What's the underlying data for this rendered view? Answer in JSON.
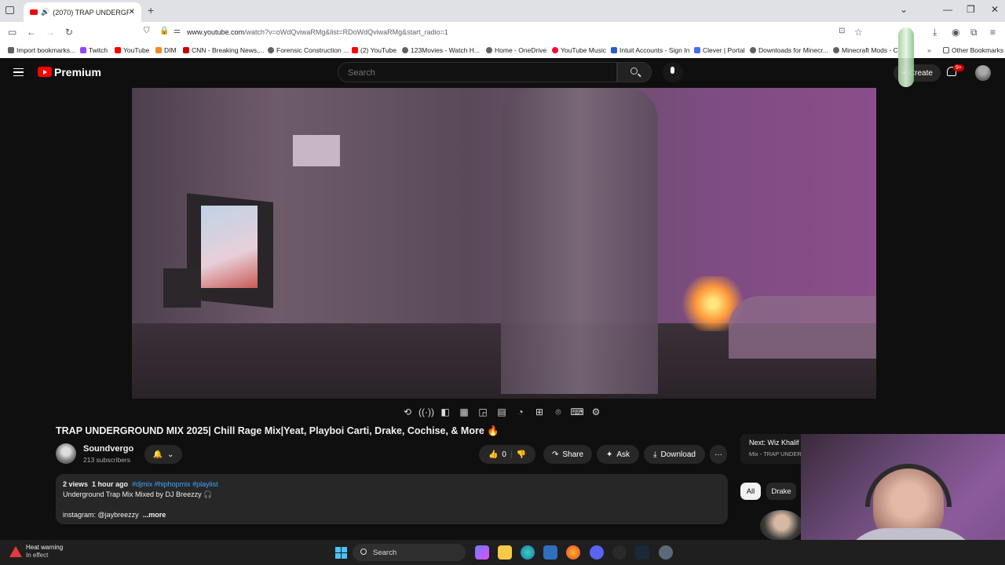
{
  "browser": {
    "tab_title": "(2070) TRAP UNDERGROUND",
    "new_tab": "+",
    "close_tab": "✕",
    "url_host": "www.youtube.com",
    "url_path": "/watch?v=oWdQviwaRMg&list=RDoWdQviwaRMg&start_radio=1",
    "window_controls": [
      "⌄",
      "—",
      "❐",
      "✕"
    ]
  },
  "bookmarks": [
    {
      "label": "Import bookmarks...",
      "color": "#5f6368"
    },
    {
      "label": "Twitch",
      "color": "#9146ff"
    },
    {
      "label": "YouTube",
      "color": "#ff0000"
    },
    {
      "label": "DIM",
      "color": "#f08a24"
    },
    {
      "label": "CNN - Breaking News,...",
      "color": "#cc0000"
    },
    {
      "label": "Forensic Construction ...",
      "color": "#5f6368"
    },
    {
      "label": "(2) YouTube",
      "color": "#ff0000"
    },
    {
      "label": "123Movies - Watch H...",
      "color": "#5f6368"
    },
    {
      "label": "Home - OneDrive",
      "color": "#5f6368"
    },
    {
      "label": "YouTube Music",
      "color": "#ff0033"
    },
    {
      "label": "Intuit Accounts - Sign In",
      "color": "#2c5dcd"
    },
    {
      "label": "Clever | Portal",
      "color": "#436cf2"
    },
    {
      "label": "Downloads for Minecr...",
      "color": "#5f6368"
    },
    {
      "label": "Minecraft Mods - C",
      "color": "#5f6368"
    }
  ],
  "other_bookmarks": "Other Bookmarks",
  "youtube": {
    "brand": "Premium",
    "search_placeholder": "Search",
    "create_label": "Create",
    "notif_count": "9+"
  },
  "video": {
    "title": "TRAP UNDERGROUND MIX 2025| Chill Rage Mix|Yeat, Playboi Carti, Drake, Cochise, & More 🔥",
    "channel": "Soundvergo",
    "subscribers": "213 subscribers",
    "likes": "0",
    "share_label": "Share",
    "ask_label": "Ask",
    "download_label": "Download",
    "more_label": "···"
  },
  "description": {
    "views": "2 views",
    "age": "1 hour ago",
    "tags": "#djmix #hiphopmix #playlist",
    "line2": "Underground Trap Mix Mixed by DJ Breezzy 🎧",
    "line3": "instagram: @jaybreezzy",
    "more": "...more"
  },
  "sidebar": {
    "next_title": "Next: Wiz Khalif",
    "next_sub": "Mix - TRAP UNDER",
    "chips": [
      "All",
      "Drake"
    ]
  },
  "taskbar": {
    "heat_title": "Heat warning",
    "heat_sub": "In effect",
    "search": "Search"
  }
}
